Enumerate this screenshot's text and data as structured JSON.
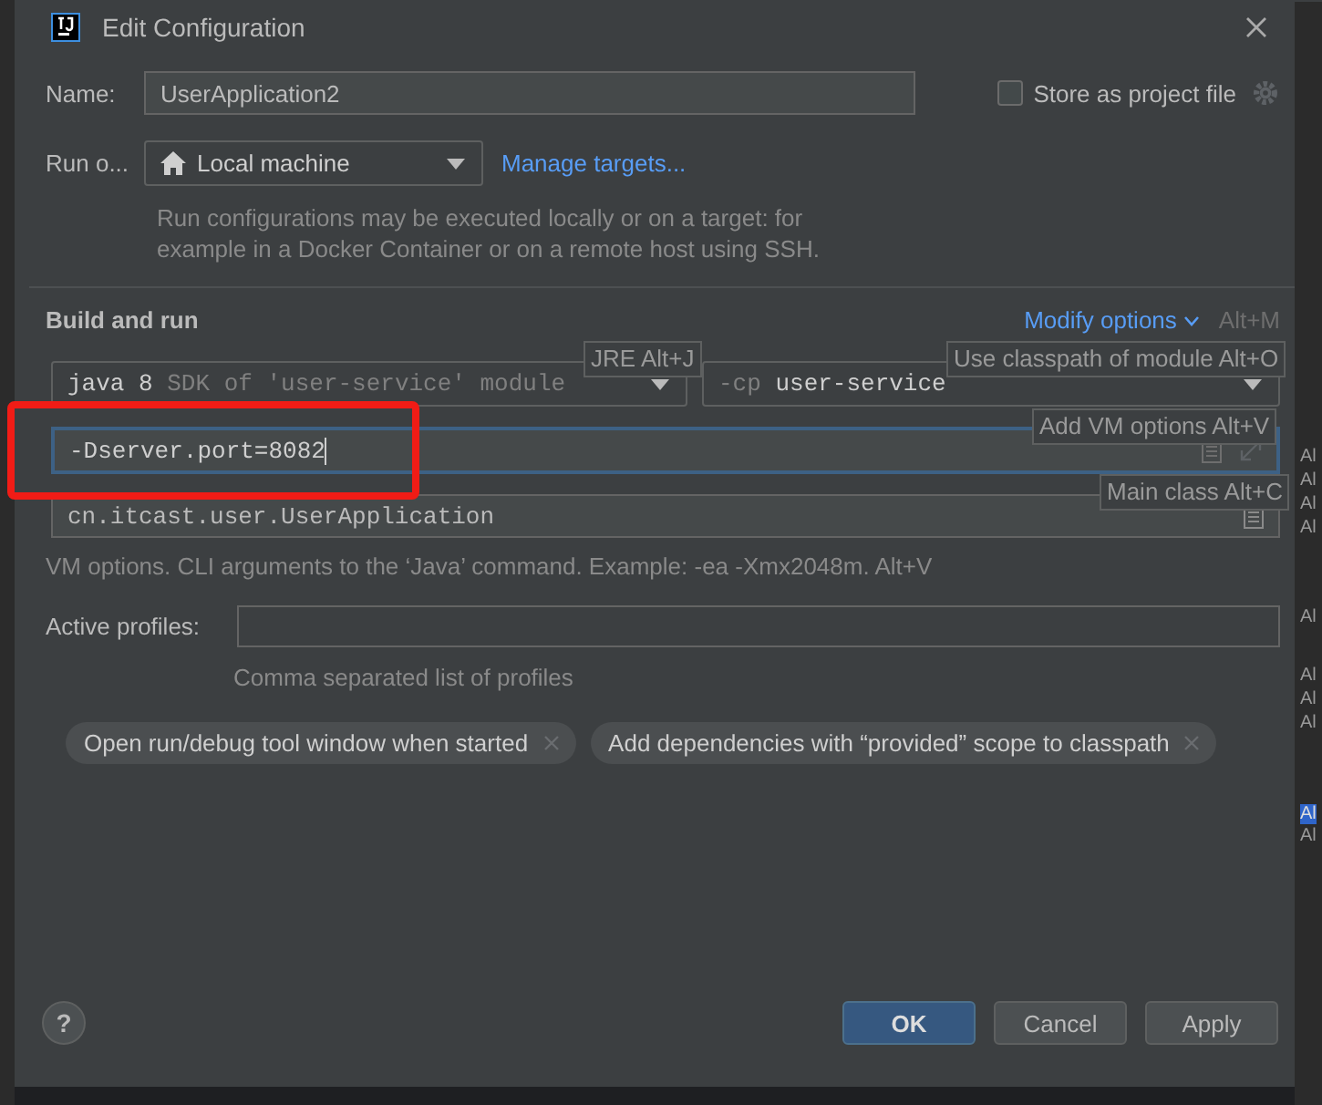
{
  "background": {
    "right_fragments": [
      {
        "text": "Al",
        "selected": false
      },
      {
        "text": "Al",
        "selected": false
      },
      {
        "text": "Al",
        "selected": false
      },
      {
        "text": "Al",
        "selected": false
      },
      {
        "text": "Al",
        "selected": false
      },
      {
        "text": "Al",
        "selected": false
      },
      {
        "text": "Al",
        "selected": false
      },
      {
        "text": "Al",
        "selected": false
      },
      {
        "text": "Al",
        "selected": true
      },
      {
        "text": "Al",
        "selected": false
      }
    ]
  },
  "window": {
    "title": "Edit Configuration"
  },
  "name": {
    "label": "Name:",
    "value": "UserApplication2"
  },
  "store_as_project_file": {
    "label": "Store as project file",
    "checked": false
  },
  "run_on": {
    "label": "Run o...",
    "value": "Local machine",
    "link": "Manage targets...",
    "description_lines": [
      "Run configurations may be executed locally or on a target: for",
      "example in a Docker Container or on a remote host using SSH."
    ]
  },
  "build_and_run": {
    "title": "Build and run",
    "modify_link": "Modify options",
    "modify_shortcut": "Alt+M",
    "jre": {
      "version": "java 8",
      "detail": "SDK of 'user-service' module"
    },
    "classpath": {
      "prefix": "-cp",
      "value": "user-service"
    },
    "vm_options": {
      "value": "-Dserver.port=8082",
      "focused": true,
      "highlighted": true
    },
    "main_class": "cn.itcast.user.UserApplication",
    "hint": "VM options. CLI arguments to the ‘Java’ command. Example: -ea -Xmx2048m. Alt+V"
  },
  "shortcut_hints": [
    {
      "label": "JRE Alt+J"
    },
    {
      "label": "Use classpath of module Alt+O"
    },
    {
      "label": "Add VM options Alt+V"
    },
    {
      "label": "Main class Alt+C"
    }
  ],
  "active_profiles": {
    "label": "Active profiles:",
    "hint": "Comma separated list of profiles"
  },
  "options": [
    {
      "label": "Open run/debug tool window when started"
    },
    {
      "label": "Add dependencies with “provided” scope to classpath"
    }
  ],
  "help_button": {
    "label": "?"
  },
  "buttons": [
    {
      "label": "OK",
      "kind": "primary"
    },
    {
      "label": "Cancel",
      "kind": "normal"
    },
    {
      "label": "Apply",
      "kind": "normal"
    }
  ]
}
